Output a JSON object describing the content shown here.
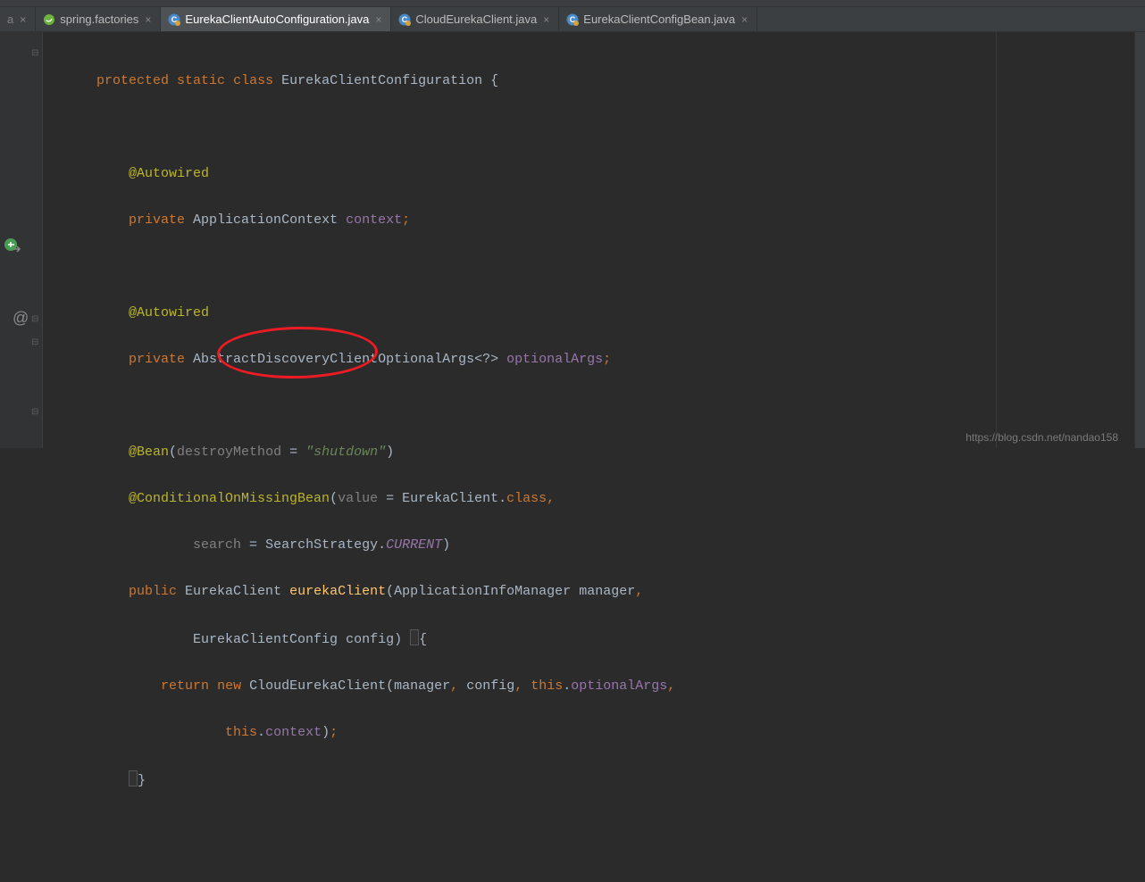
{
  "tabs": [
    {
      "label": "a",
      "icon": "none",
      "partial": true
    },
    {
      "label": "spring.factories",
      "icon": "spring"
    },
    {
      "label": "EurekaClientAutoConfiguration.java",
      "icon": "java",
      "active": true
    },
    {
      "label": "CloudEurekaClient.java",
      "icon": "java"
    },
    {
      "label": "EurekaClientConfigBean.java",
      "icon": "java"
    }
  ],
  "code": {
    "line1": {
      "kw1": "protected",
      "kw2": "static",
      "kw3": "class",
      "name": "EurekaClientConfiguration",
      "brace": "{"
    },
    "line3": {
      "ann": "@Autowired"
    },
    "line4": {
      "kw": "private",
      "type": "ApplicationContext",
      "field": "context",
      "semi": ";"
    },
    "line6": {
      "ann": "@Autowired"
    },
    "line7": {
      "kw": "private",
      "type": "AbstractDiscoveryClientOptionalArgs",
      "gen": "<?>",
      "field": "optionalArgs",
      "semi": ";"
    },
    "line9": {
      "ann": "@Bean",
      "paramName": "destroyMethod",
      "eq": " = ",
      "str": "\"shutdown\""
    },
    "line10": {
      "ann": "@ConditionalOnMissingBean",
      "p1": "value",
      "eq1": " = ",
      "v1a": "EurekaClient",
      "v1b": "class"
    },
    "line11": {
      "p2": "search",
      "eq2": " = ",
      "v2a": "SearchStrategy",
      "v2b": "CURRENT"
    },
    "line12": {
      "kw": "public",
      "ret": "EurekaClient",
      "method": "eurekaClient",
      "p1t": "ApplicationInfoManager",
      "p1n": "manager"
    },
    "line13": {
      "p2t": "EurekaClientConfig",
      "p2n": "config",
      "brace": "{"
    },
    "line14": {
      "kw1": "return",
      "kw2": "new",
      "ctor": "CloudEurekaClient",
      "a1": "manager",
      "a2": "config",
      "kw3": "this",
      "a3": "optionalArgs"
    },
    "line15": {
      "kw": "this",
      "a4": "context"
    },
    "line16": {
      "brace": "}"
    }
  },
  "watermark": "https://blog.csdn.net/nandao158"
}
